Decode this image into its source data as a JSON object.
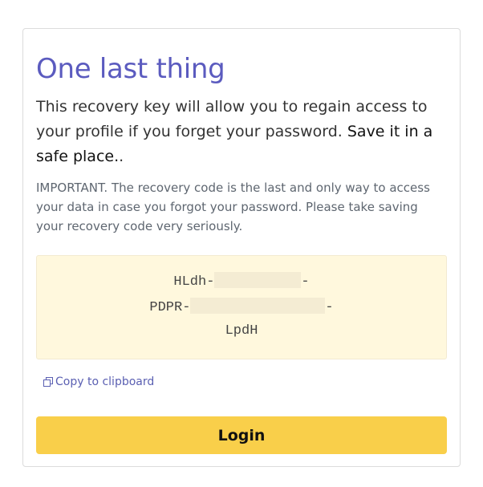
{
  "card": {
    "title": "One last thing",
    "lead_text": "This recovery key will allow you to regain access to your profile if you forget your password. ",
    "lead_strong": "Save it in a safe place.",
    "lead_tail": ".",
    "important_note": "IMPORTANT. The recovery code is the last and only way to access your data in case you forgot your password. Please take saving your recovery code very seriously."
  },
  "recovery_key": {
    "line1_prefix": "HLdh-",
    "line1_suffix": "-",
    "line2_prefix": "PDPR-",
    "line2_suffix": "-",
    "line3": "LpdH"
  },
  "actions": {
    "copy_label": "Copy to clipboard",
    "copy_icon": "copy-icon",
    "login_label": "Login"
  },
  "colors": {
    "title": "#5b5bbf",
    "key_background": "#fff8dd",
    "login_button": "#f9cf4a",
    "link": "#5a5fb2"
  }
}
